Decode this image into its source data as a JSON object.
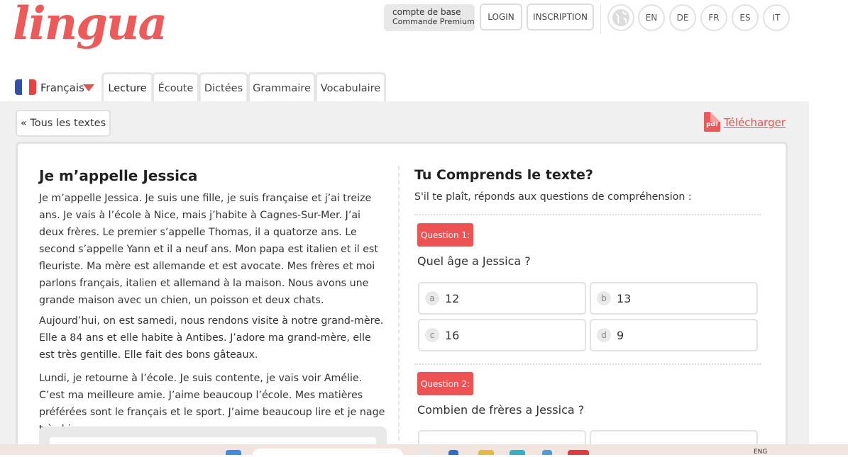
{
  "logo": "lingua",
  "header": {
    "account_title": "compte de base",
    "account_sub": "Commande Premium",
    "login": "LOGIN",
    "signup": "INSCRIPTION",
    "languages": [
      "EN",
      "DE",
      "FR",
      "ES",
      "IT"
    ]
  },
  "nav": {
    "language": "Français",
    "tabs": [
      "Lecture",
      "Écoute",
      "Dictées",
      "Grammaire",
      "Vocabulaire"
    ],
    "active_tab": "Lecture"
  },
  "toolbar": {
    "back": "« Tous les textes",
    "pdf_label": "pdf",
    "download": "Télécharger"
  },
  "text": {
    "title": "Je m’appelle Jessica",
    "paragraphs": [
      "Je m’appelle Jessica. Je suis une fille, je suis française et j’ai treize ans. Je vais à l’école à Nice, mais j’habite à Cagnes-Sur-Mer. J’ai deux frères. Le premier s’appelle Thomas, il a quatorze ans. Le second s’appelle Yann et il a neuf ans. Mon papa est italien et il est fleuriste. Ma mère est allemande et est avocate. Mes frères et moi parlons français, italien et allemand à la maison. Nous avons une grande maison avec un chien, un poisson et deux chats.",
      "Aujourd’hui, on est samedi, nous rendons visite à notre grand-mère. Elle a 84 ans et elle habite à Antibes. J’adore ma grand-mère, elle est très gentille. Elle fait des bons gâteaux.",
      "Lundi, je retourne à l’école. Je suis contente, je vais voir Amélie. C’est ma meilleure amie. J’aime beaucoup l’école. Mes matières préférées sont le français et le sport. J’aime beaucoup lire et je nage très bien."
    ]
  },
  "quiz": {
    "title": "Tu Comprends le texte?",
    "subtitle": "S'il te plaît, réponds aux questions de compréhension :",
    "questions": [
      {
        "badge": "Question 1:",
        "text": "Quel âge a Jessica ?",
        "options": [
          {
            "letter": "a",
            "value": "12"
          },
          {
            "letter": "b",
            "value": "13"
          },
          {
            "letter": "c",
            "value": "16"
          },
          {
            "letter": "d",
            "value": "9"
          }
        ]
      },
      {
        "badge": "Question 2:",
        "text": "Combien de frères a Jessica ?"
      }
    ]
  },
  "taskbar": {
    "lang": "ENG"
  },
  "colors": {
    "accent": "#ee5353",
    "border": "#e2e2e2",
    "background_gray": "#f0f0f0"
  }
}
